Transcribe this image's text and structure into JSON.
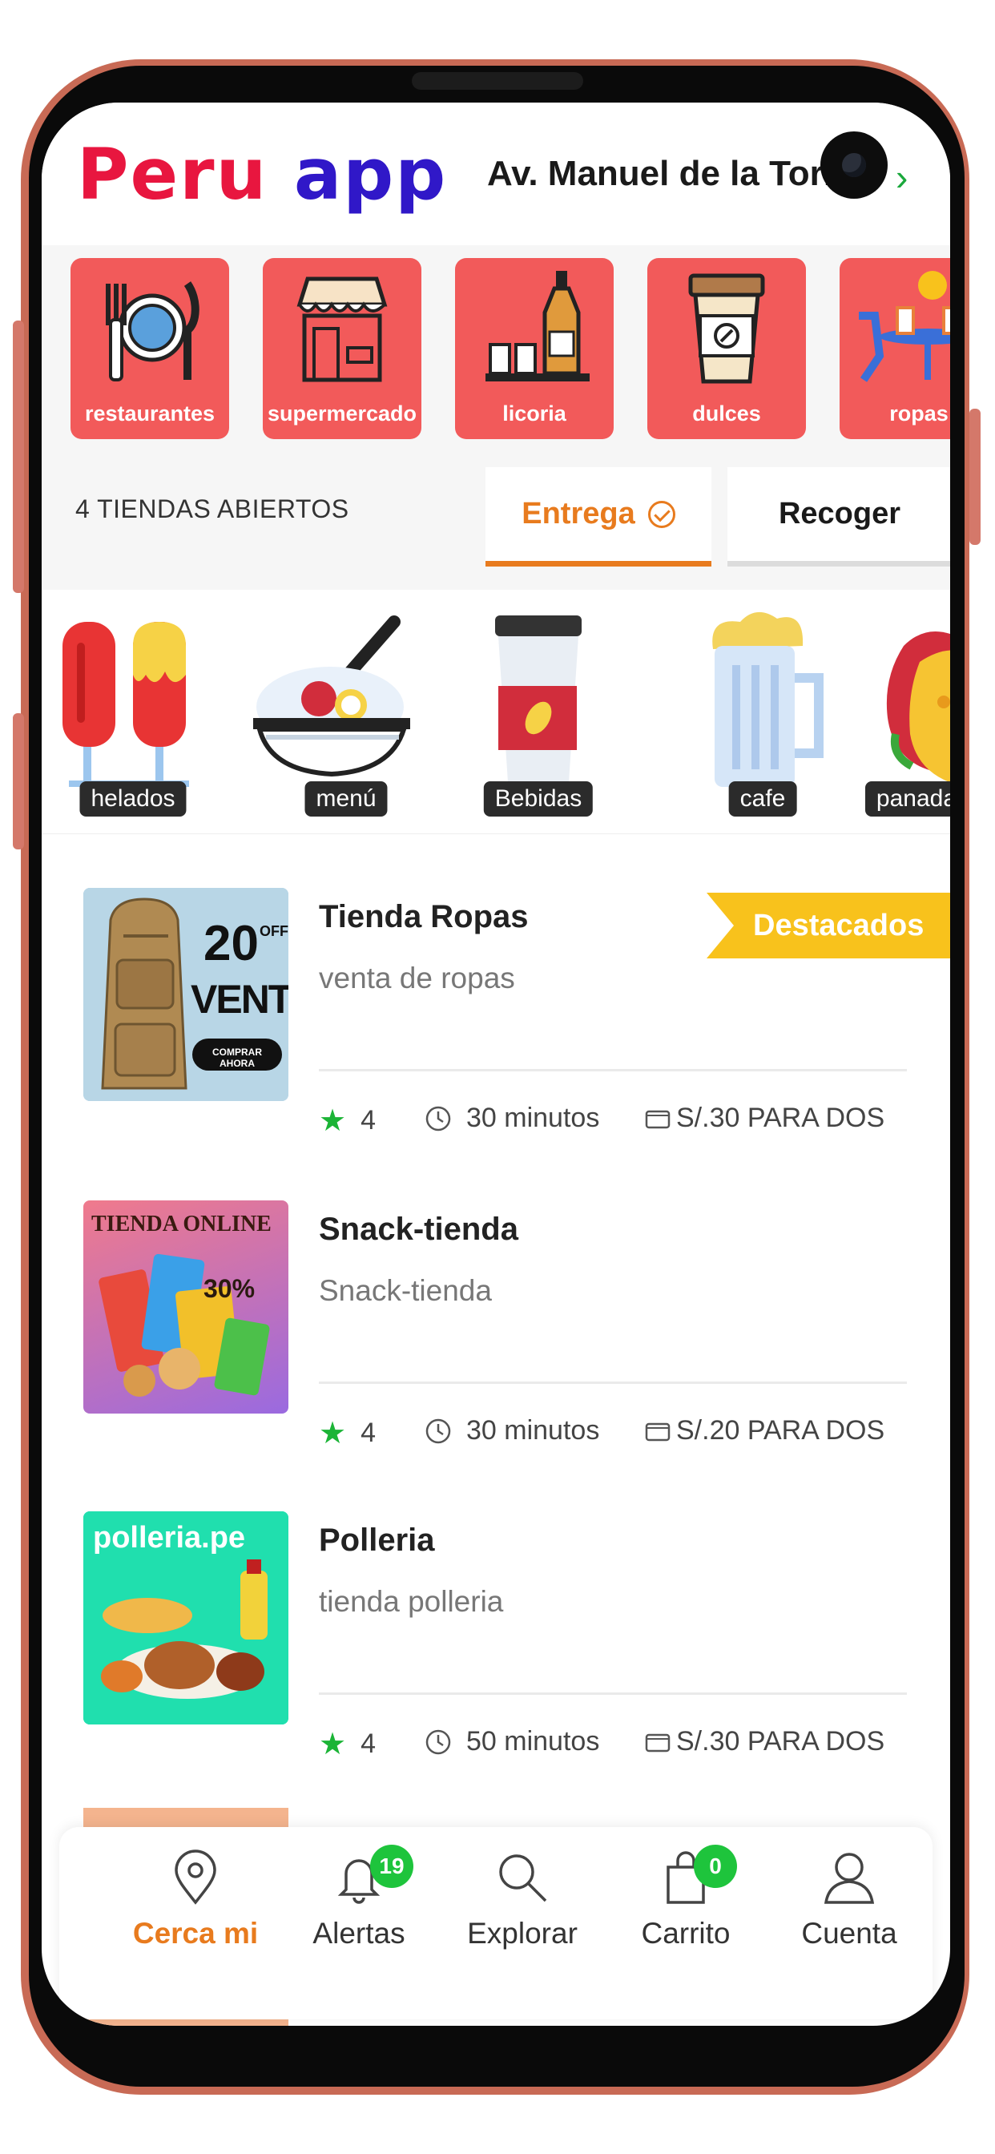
{
  "header": {
    "logo_part1": "Peru",
    "logo_part2": "app",
    "address": "Av. Manuel de la Torre",
    "address_chevron": "›"
  },
  "categories": [
    {
      "label": "restaurantes",
      "icon": "plate-cutlery-icon"
    },
    {
      "label": "supermercado",
      "icon": "store-front-icon"
    },
    {
      "label": "licoria",
      "icon": "bottle-glasses-icon"
    },
    {
      "label": "dulces",
      "icon": "coffee-cup-icon"
    },
    {
      "label": "ropas",
      "icon": "cafe-table-icon"
    }
  ],
  "status": {
    "open_count": "4 TIENDAS ABIERTOS",
    "tab_delivery": "Entrega",
    "tab_pickup": "Recoger",
    "active_tab": "Entrega"
  },
  "foods": [
    {
      "label": "helados",
      "icon": "popsicle-icon"
    },
    {
      "label": "menú",
      "icon": "rice-bowl-icon"
    },
    {
      "label": "Bebidas",
      "icon": "drink-cup-icon"
    },
    {
      "label": "cafe",
      "icon": "beer-mug-icon"
    },
    {
      "label": "panada",
      "icon": "taco-icon"
    }
  ],
  "stores": [
    {
      "name": "Tienda Ropas",
      "description": "venta de ropas",
      "rating": "4",
      "time": "30 minutos",
      "price": "S/.30 PARA DOS",
      "badge": "Destacados",
      "thumb_text": {
        "pct": "20",
        "off": "OFF",
        "venta": "VENTA",
        "cta": "COMPRAR AHORA"
      }
    },
    {
      "name": "Snack-tienda",
      "description": "Snack-tienda",
      "rating": "4",
      "time": "30 minutos",
      "price": "S/.20 PARA DOS",
      "thumb_text": {
        "title": "TIENDA ONLINE",
        "pct": "30%"
      }
    },
    {
      "name": "Polleria",
      "description": "tienda polleria",
      "rating": "4",
      "time": "50 minutos",
      "price": "S/.30 PARA DOS",
      "thumb_text": {
        "title": "polleria.pe"
      }
    }
  ],
  "nav": [
    {
      "label": "Cerca mi",
      "icon": "location-pin-icon",
      "active": true
    },
    {
      "label": "Alertas",
      "icon": "bell-icon",
      "badge": "19"
    },
    {
      "label": "Explorar",
      "icon": "search-icon"
    },
    {
      "label": "Carrito",
      "icon": "shopping-bag-icon",
      "badge": "0"
    },
    {
      "label": "Cuenta",
      "icon": "user-icon"
    }
  ],
  "colors": {
    "accent": "#e87b1e",
    "category_bg": "#f25a5a",
    "badge_green": "#1ec43c",
    "featured_yellow": "#f8c21c",
    "logo_red": "#e8163f",
    "logo_blue": "#3018c8"
  }
}
